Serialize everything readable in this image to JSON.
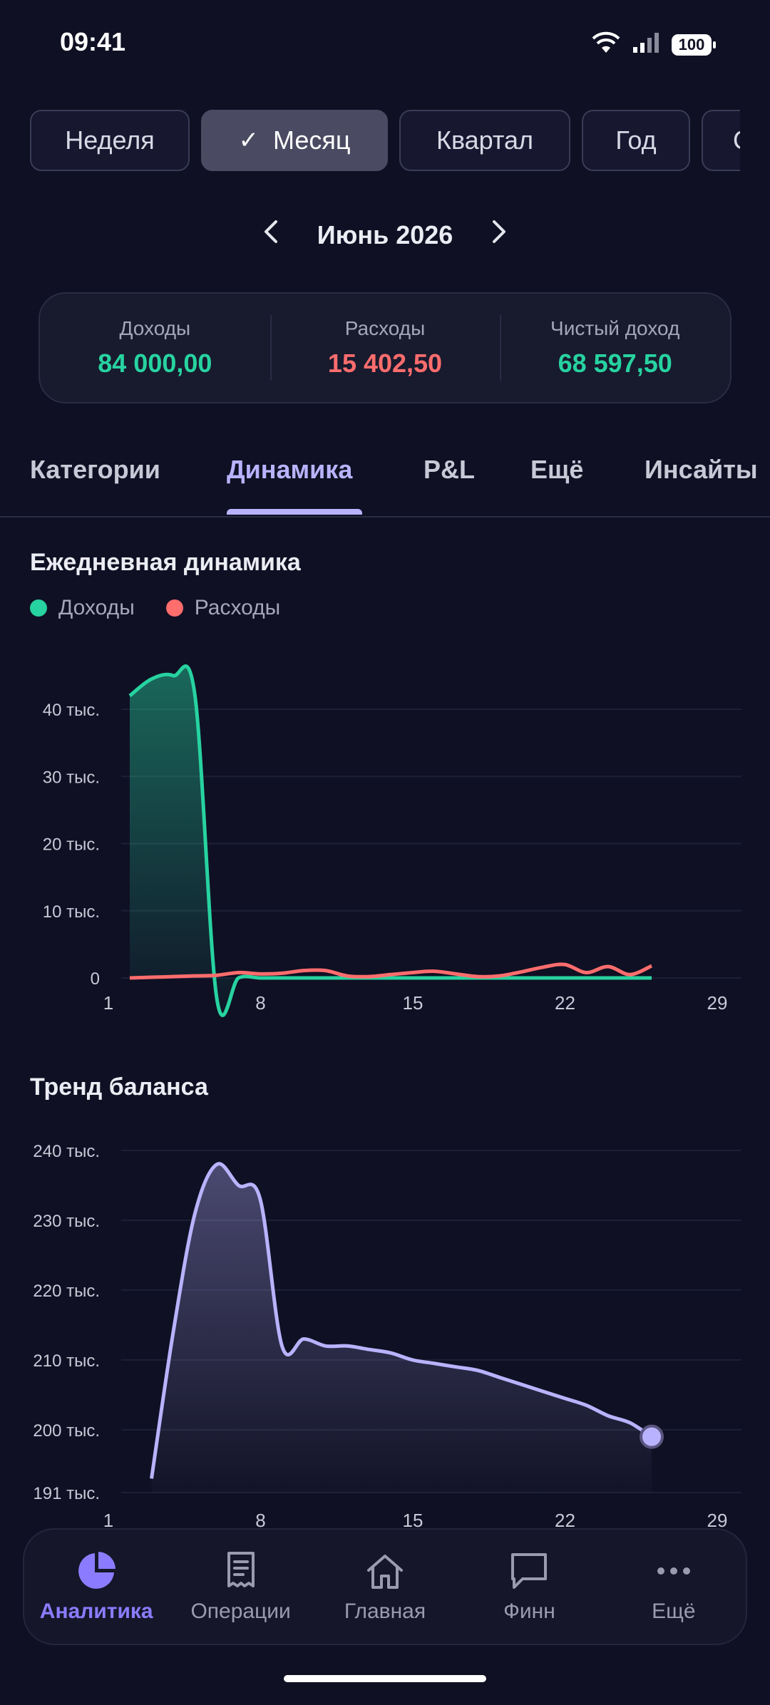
{
  "status": {
    "time": "09:41",
    "battery": "100"
  },
  "period_chips": [
    {
      "label": "Неделя",
      "active": false
    },
    {
      "label": "Месяц",
      "active": true
    },
    {
      "label": "Квартал",
      "active": false
    },
    {
      "label": "Год",
      "active": false
    },
    {
      "label": "С",
      "active": false
    }
  ],
  "month_nav": {
    "label": "Июнь 2026",
    "prev_icon": "chevron-left-icon",
    "next_icon": "chevron-right-icon"
  },
  "summary": {
    "income_label": "Доходы",
    "income_value": "84 000,00",
    "expense_label": "Расходы",
    "expense_value": "15 402,50",
    "net_label": "Чистый доход",
    "net_value": "68 597,50"
  },
  "tabs": [
    {
      "label": "Категории",
      "active": false
    },
    {
      "label": "Динамика",
      "active": true
    },
    {
      "label": "P&L",
      "active": false
    },
    {
      "label": "Ещё",
      "active": false
    },
    {
      "label": "Инсайты",
      "active": false
    }
  ],
  "daily_section": {
    "title": "Ежедневная динамика",
    "legend_income": "Доходы",
    "legend_expense": "Расходы"
  },
  "balance_section": {
    "title": "Тренд баланса"
  },
  "colors": {
    "income": "#27d3a0",
    "expense": "#ff6d6d",
    "balance": "#b9b3ff",
    "accent": "#8b7cff"
  },
  "chart_data": [
    {
      "type": "line",
      "title": "Ежедневная динамика",
      "x_ticks": [
        "1",
        "8",
        "15",
        "22",
        "29"
      ],
      "y_ticks": [
        "0",
        "10 тыс.",
        "20 тыс.",
        "30 тыс.",
        "40 тыс."
      ],
      "xlim": [
        1,
        29
      ],
      "ylim": [
        0,
        40000
      ],
      "series": [
        {
          "name": "Доходы",
          "x": [
            1,
            2,
            3,
            4,
            5,
            6,
            7,
            8,
            9,
            10,
            11,
            12,
            13,
            14,
            15,
            16,
            17,
            18,
            19,
            20,
            21,
            22,
            23,
            24,
            25
          ],
          "y": [
            42000,
            44500,
            45000,
            42000,
            -3000,
            0,
            0,
            0,
            0,
            0,
            0,
            0,
            0,
            0,
            0,
            0,
            0,
            0,
            0,
            0,
            0,
            0,
            0,
            0,
            0
          ]
        },
        {
          "name": "Расходы",
          "x": [
            1,
            2,
            3,
            4,
            5,
            6,
            7,
            8,
            9,
            10,
            11,
            12,
            13,
            14,
            15,
            16,
            17,
            18,
            19,
            20,
            21,
            22,
            23,
            24,
            25
          ],
          "y": [
            0,
            100,
            200,
            300,
            400,
            800,
            600,
            700,
            1100,
            1100,
            300,
            200,
            500,
            800,
            1000,
            600,
            200,
            300,
            900,
            1600,
            2000,
            800,
            1700,
            500,
            1800
          ]
        }
      ]
    },
    {
      "type": "area",
      "title": "Тренд баланса",
      "x_ticks": [
        "1",
        "8",
        "15",
        "22",
        "29"
      ],
      "y_ticks": [
        "191 тыс.",
        "200 тыс.",
        "210 тыс.",
        "220 тыс.",
        "230 тыс.",
        "240 тыс."
      ],
      "xlim": [
        1,
        29
      ],
      "ylim": [
        191000,
        240000
      ],
      "series": [
        {
          "x": [
            2,
            3,
            4,
            5,
            6,
            7,
            8,
            9,
            10,
            11,
            12,
            13,
            14,
            15,
            16,
            17,
            18,
            19,
            20,
            21,
            22,
            23,
            24,
            25
          ],
          "y": [
            193000,
            214000,
            231000,
            238000,
            235000,
            233000,
            212000,
            213000,
            212000,
            212000,
            211500,
            211000,
            210000,
            209500,
            209000,
            208500,
            207500,
            206500,
            205500,
            204500,
            203500,
            202000,
            201000,
            199000
          ]
        }
      ]
    }
  ],
  "bottom_nav": [
    {
      "label": "Аналитика",
      "icon": "pie-chart-icon",
      "active": true
    },
    {
      "label": "Операции",
      "icon": "receipt-icon",
      "active": false
    },
    {
      "label": "Главная",
      "icon": "home-icon",
      "active": false
    },
    {
      "label": "Финн",
      "icon": "chat-bubble-icon",
      "active": false
    },
    {
      "label": "Ещё",
      "icon": "more-dots-icon",
      "active": false
    }
  ]
}
